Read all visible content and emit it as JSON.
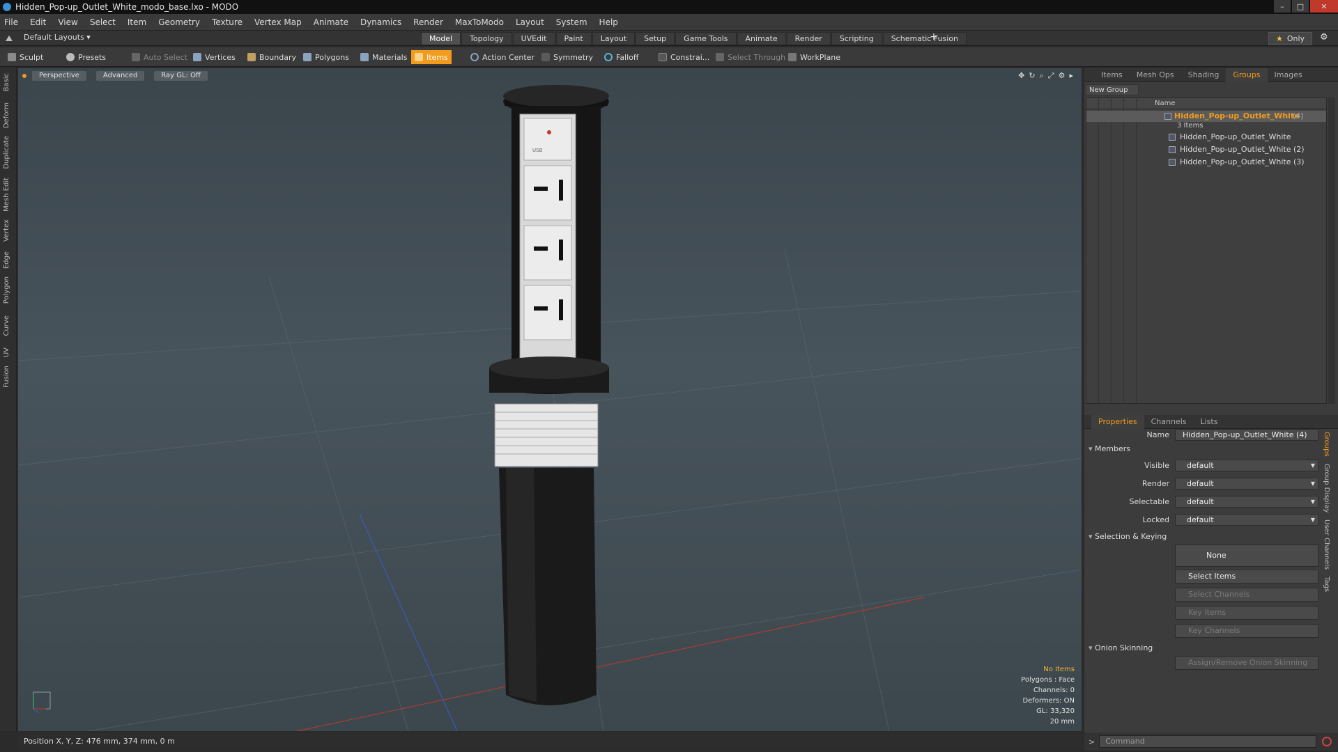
{
  "window": {
    "title": "Hidden_Pop-up_Outlet_White_modo_base.lxo - MODO",
    "controls": [
      "–",
      "□",
      "✕"
    ]
  },
  "menu": [
    "File",
    "Edit",
    "View",
    "Select",
    "Item",
    "Geometry",
    "Texture",
    "Vertex Map",
    "Animate",
    "Dynamics",
    "Render",
    "MaxToModo",
    "Layout",
    "System",
    "Help"
  ],
  "layout_selector": "Default Layouts ▾",
  "main_tabs": [
    "Model",
    "Topology",
    "UVEdit",
    "Paint",
    "Layout",
    "Setup",
    "Game Tools",
    "Animate",
    "Render",
    "Scripting",
    "Schematic Fusion"
  ],
  "active_main_tab": "Model",
  "only_label": "Only",
  "toolbar": {
    "sculpt": "Sculpt",
    "presets": "Presets",
    "auto_select": "Auto Select",
    "vertices": "Vertices",
    "boundary": "Boundary",
    "polygons": "Polygons",
    "materials": "Materials",
    "items": "Items",
    "action_center": "Action Center",
    "symmetry": "Symmetry",
    "falloff": "Falloff",
    "constrain": "Constrai...",
    "select_through": "Select Through",
    "workplane": "WorkPlane"
  },
  "left_tabs": [
    "Basic",
    "Deform",
    "Duplicate",
    "Mesh Edit",
    "Vertex",
    "Edge",
    "Polygon",
    "Curve",
    "UV",
    "Fusion"
  ],
  "viewport": {
    "view_mode": "Perspective",
    "shading": "Advanced",
    "raygl": "Ray GL: Off",
    "hud": {
      "items": "No Items",
      "polygons": "Polygons : Face",
      "channels": "Channels: 0",
      "deformers": "Deformers: ON",
      "gl": "GL: 33,320",
      "scale": "20 mm"
    },
    "model_labels": {
      "usb": "USB"
    }
  },
  "status": {
    "label": "Position X, Y, Z:",
    "value": "476 mm, 374 mm, 0 m"
  },
  "panel_tabs": [
    "Items",
    "Mesh Ops",
    "Shading",
    "Groups",
    "Images"
  ],
  "active_panel_tab": "Groups",
  "new_group": "New Group",
  "tree": {
    "column_name": "Name",
    "group": {
      "label": "Hidden_Pop-up_Outlet_White",
      "count": "(4)",
      "sub": "3 Items"
    },
    "children": [
      "Hidden_Pop-up_Outlet_White",
      "Hidden_Pop-up_Outlet_White (2)",
      "Hidden_Pop-up_Outlet_White (3)"
    ]
  },
  "prop_tabs": [
    "Properties",
    "Channels",
    "Lists"
  ],
  "properties": {
    "name_label": "Name",
    "name_value": "Hidden_Pop-up_Outlet_White (4)",
    "members": "Members",
    "visible_label": "Visible",
    "visible": "default",
    "render_label": "Render",
    "render": "default",
    "selectable_label": "Selectable",
    "selectable": "default",
    "locked_label": "Locked",
    "locked": "default",
    "selection_keying": "Selection & Keying",
    "none": "None",
    "select_items": "Select Items",
    "select_channels": "Select Channels",
    "key_items": "Key Items",
    "key_channels": "Key Channels",
    "onion": "Onion Skinning",
    "assign_onion": "Assign/Remove Onion Skinning"
  },
  "side_tabs": [
    "Groups",
    "Group Display",
    "User Channels",
    "Tags"
  ],
  "command_placeholder": "Command",
  "colors": {
    "accent": "#f29b1d",
    "viewport": "#44515a"
  }
}
